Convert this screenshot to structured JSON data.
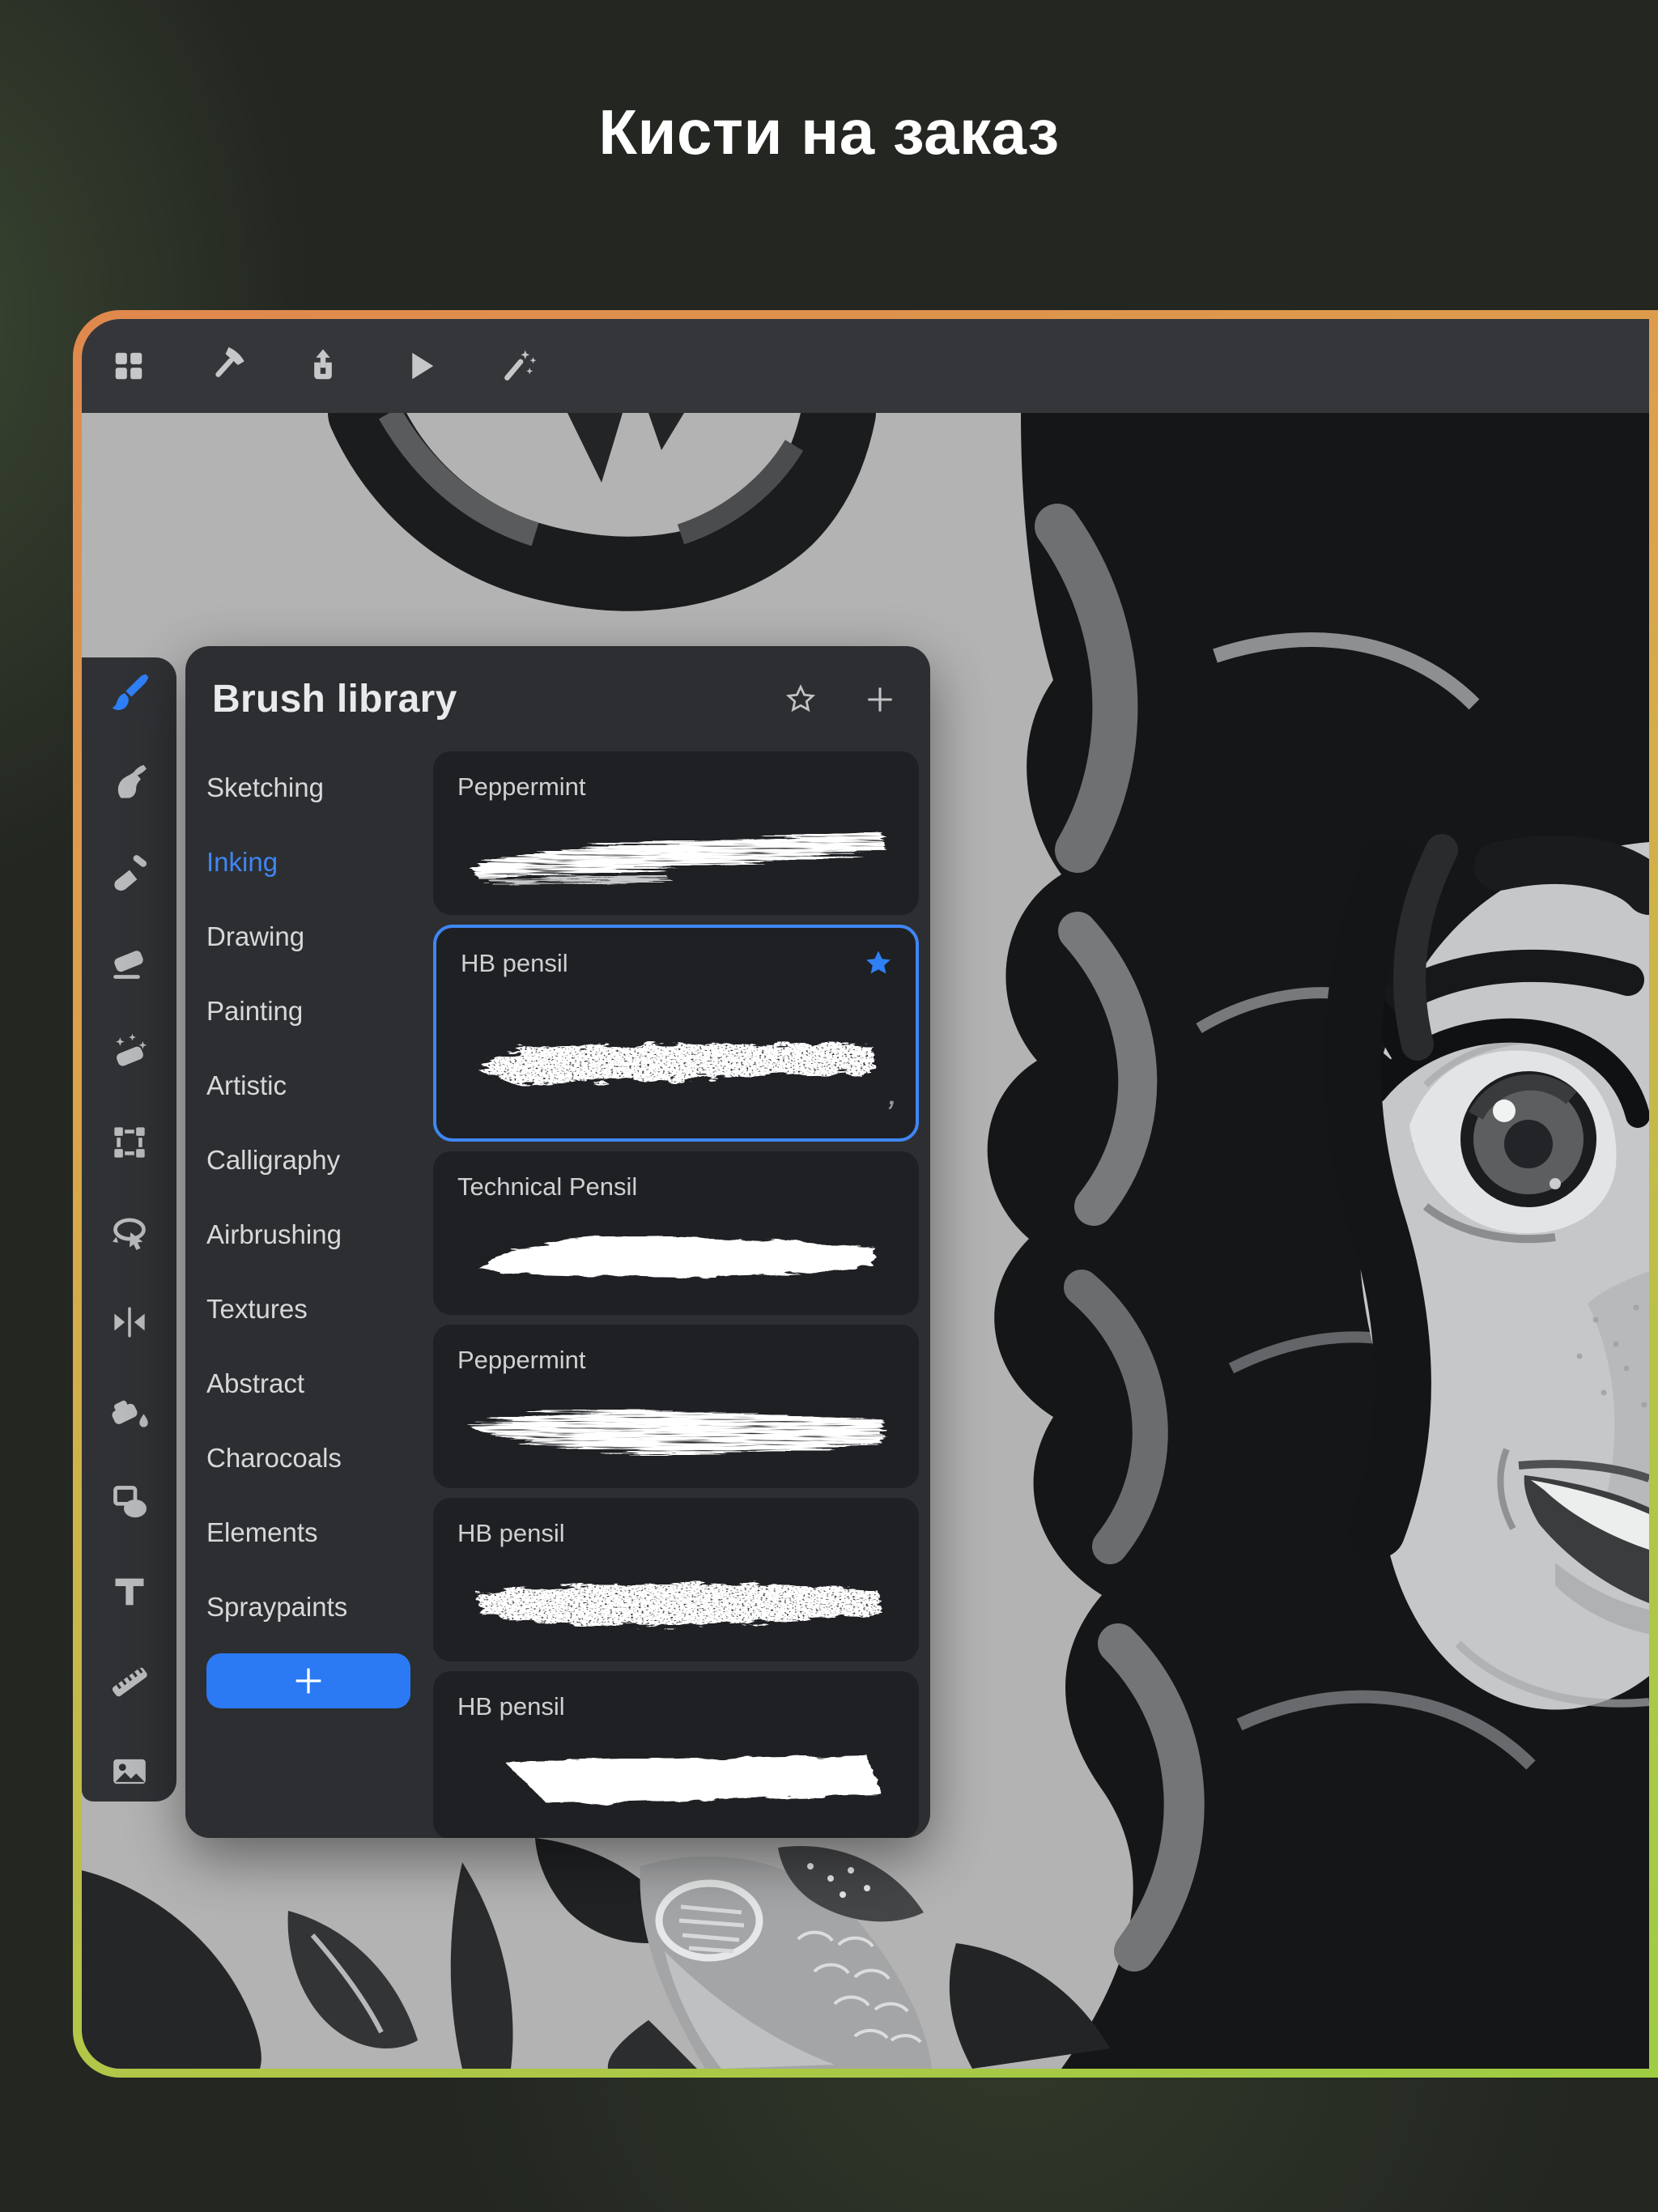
{
  "page": {
    "title": "Кисти на заказ"
  },
  "window": {
    "toolbar": {
      "buttons": [
        {
          "icon": "gallery-icon"
        },
        {
          "icon": "actions-icon"
        },
        {
          "icon": "share-icon"
        },
        {
          "icon": "play-icon"
        },
        {
          "icon": "magic-wand-icon"
        }
      ]
    },
    "sidebar": {
      "tools": [
        {
          "icon": "paint-brush-icon",
          "active": true
        },
        {
          "icon": "smudge-icon"
        },
        {
          "icon": "flat-brush-icon"
        },
        {
          "icon": "eraser-icon"
        },
        {
          "icon": "magic-eraser-icon"
        },
        {
          "icon": "selection-icon"
        },
        {
          "icon": "transform-icon"
        },
        {
          "icon": "mirror-icon"
        },
        {
          "icon": "fill-icon"
        },
        {
          "icon": "shapes-icon"
        },
        {
          "icon": "text-icon"
        },
        {
          "icon": "ruler-icon"
        },
        {
          "icon": "image-icon"
        }
      ]
    },
    "brush_library": {
      "title": "Brush library",
      "header_buttons": [
        {
          "icon": "star-outline-icon"
        },
        {
          "icon": "plus-icon"
        }
      ],
      "categories": [
        {
          "label": "Sketching"
        },
        {
          "label": "Inking",
          "active": true
        },
        {
          "label": "Drawing"
        },
        {
          "label": "Painting"
        },
        {
          "label": "Artistic"
        },
        {
          "label": "Calligraphy"
        },
        {
          "label": "Airbrushing"
        },
        {
          "label": "Textures"
        },
        {
          "label": "Abstract"
        },
        {
          "label": "Charocoals"
        },
        {
          "label": "Elements"
        },
        {
          "label": "Spraypaints"
        }
      ],
      "add_category": {
        "icon": "plus-icon"
      },
      "brushes": [
        {
          "name": "Peppermint",
          "stroke": "dry1"
        },
        {
          "name": "HB pensil",
          "stroke": "pencil1",
          "selected": true,
          "starred": true,
          "modified_mark": "’"
        },
        {
          "name": "Technical Pensil",
          "stroke": "soft1"
        },
        {
          "name": "Peppermint",
          "stroke": "dry2"
        },
        {
          "name": "HB pensil",
          "stroke": "pencil2"
        },
        {
          "name": "HB pensil",
          "stroke": "solid1"
        }
      ]
    }
  },
  "colors": {
    "accent": "#2f7ff6",
    "active_category": "#3f86f2",
    "border_top": "#e0884d",
    "border_mid": "#d3b04b",
    "border_bottom": "#9ecc43",
    "canvas": "#b2b3b2",
    "panel": "#2c2e31",
    "card": "#1e2023"
  }
}
